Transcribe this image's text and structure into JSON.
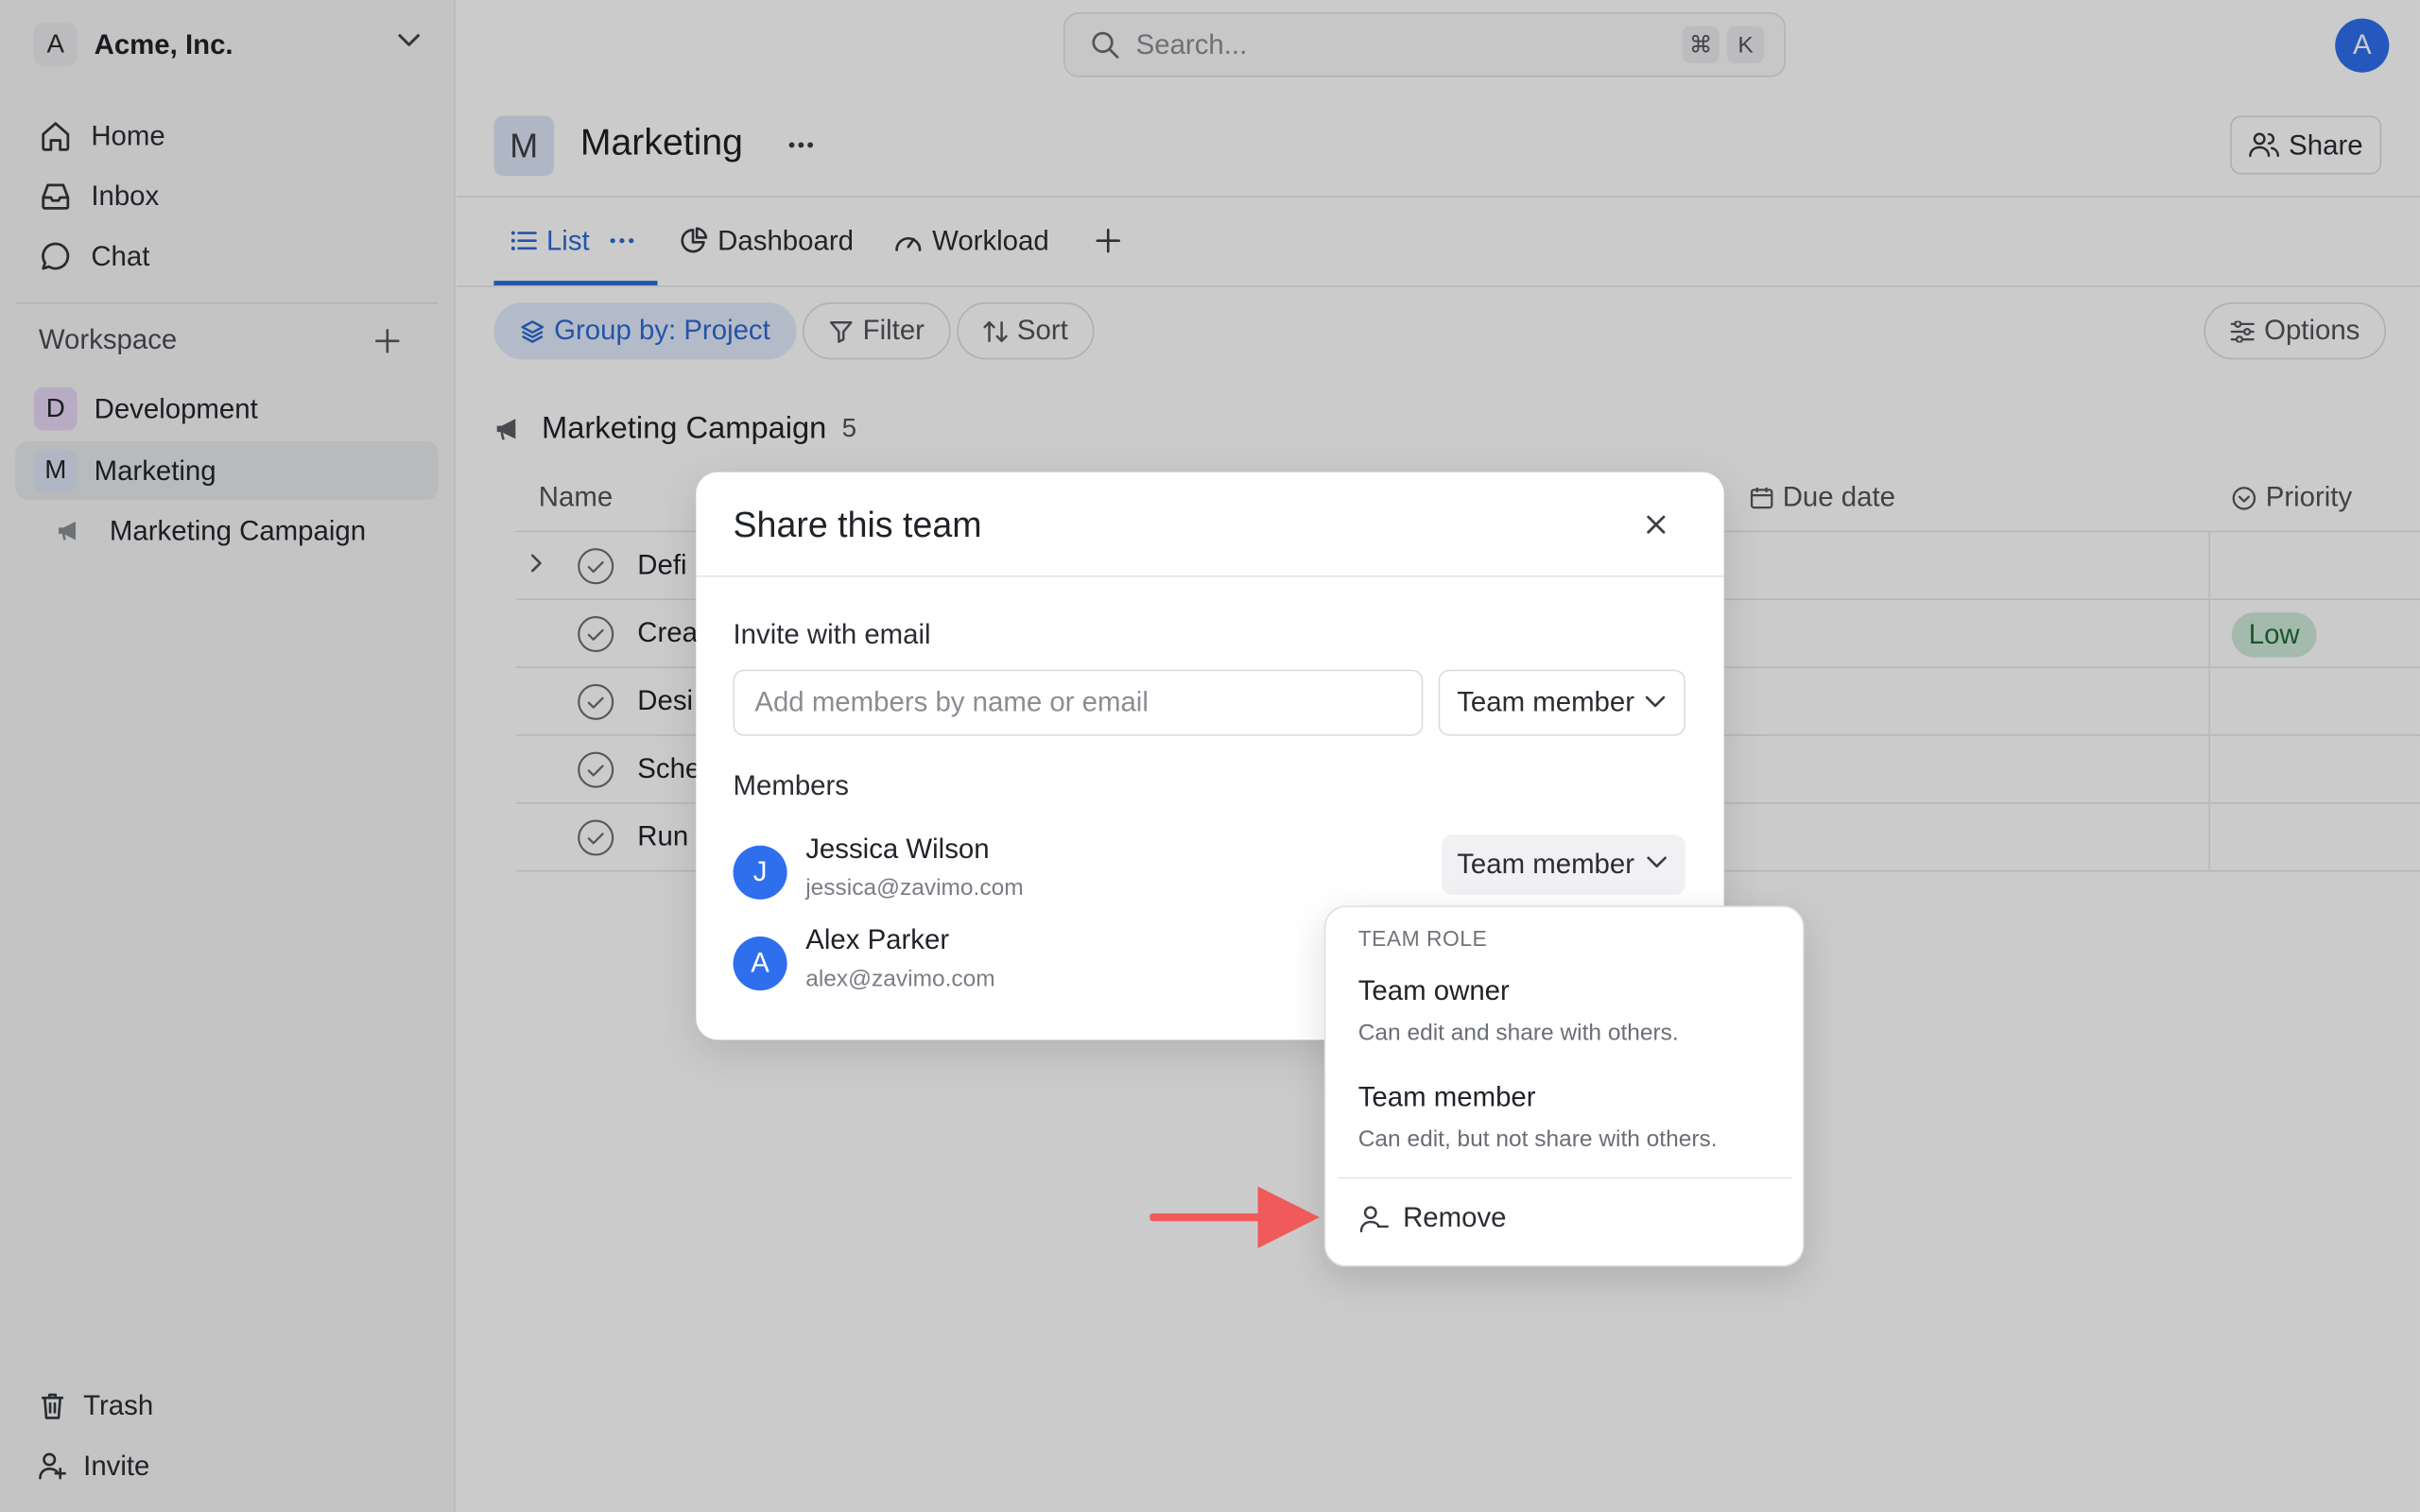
{
  "org": {
    "initial": "A",
    "name": "Acme, Inc."
  },
  "nav": {
    "home": "Home",
    "inbox": "Inbox",
    "chat": "Chat"
  },
  "workspace": {
    "label": "Workspace",
    "teams": [
      {
        "initial": "D",
        "name": "Development",
        "color": "#e6d9f5"
      },
      {
        "initial": "M",
        "name": "Marketing",
        "color": "#dde6f6"
      }
    ],
    "sub_item": "Marketing Campaign"
  },
  "sidebar_bottom": {
    "trash": "Trash",
    "invite": "Invite"
  },
  "search": {
    "placeholder": "Search...",
    "kbd_cmd": "⌘",
    "kbd_key": "K"
  },
  "user": {
    "initial": "A"
  },
  "team": {
    "initial": "M",
    "title": "Marketing",
    "share": "Share"
  },
  "tabs": {
    "list": "List",
    "dashboard": "Dashboard",
    "workload": "Workload"
  },
  "toolbar": {
    "group_by": "Group by: Project",
    "filter": "Filter",
    "sort": "Sort",
    "options": "Options"
  },
  "table": {
    "group": "Marketing Campaign",
    "count": "5",
    "col_name": "Name",
    "col_due": "Due date",
    "col_priority": "Priority",
    "rows": [
      "Defi",
      "Crea",
      "Desi",
      "Sche",
      "Run"
    ],
    "priority_low": "Low"
  },
  "modal": {
    "title": "Share this team",
    "invite_label": "Invite with email",
    "invite_placeholder": "Add members by name or email",
    "invite_role": "Team member",
    "members_label": "Members",
    "members": [
      {
        "initial": "J",
        "name": "Jessica Wilson",
        "email": "jessica@zavimo.com",
        "role": "Team member"
      },
      {
        "initial": "A",
        "name": "Alex Parker",
        "email": "alex@zavimo.com"
      }
    ]
  },
  "dropdown": {
    "header": "TEAM ROLE",
    "options": [
      {
        "title": "Team owner",
        "desc": "Can edit and share with others."
      },
      {
        "title": "Team member",
        "desc": "Can edit, but not share with others."
      }
    ],
    "remove": "Remove"
  },
  "colors": {
    "accent": "#2d6ad6",
    "avatar": "#2f6fed",
    "arrow": "#f05a5a",
    "low_pill": "#cfead8"
  }
}
